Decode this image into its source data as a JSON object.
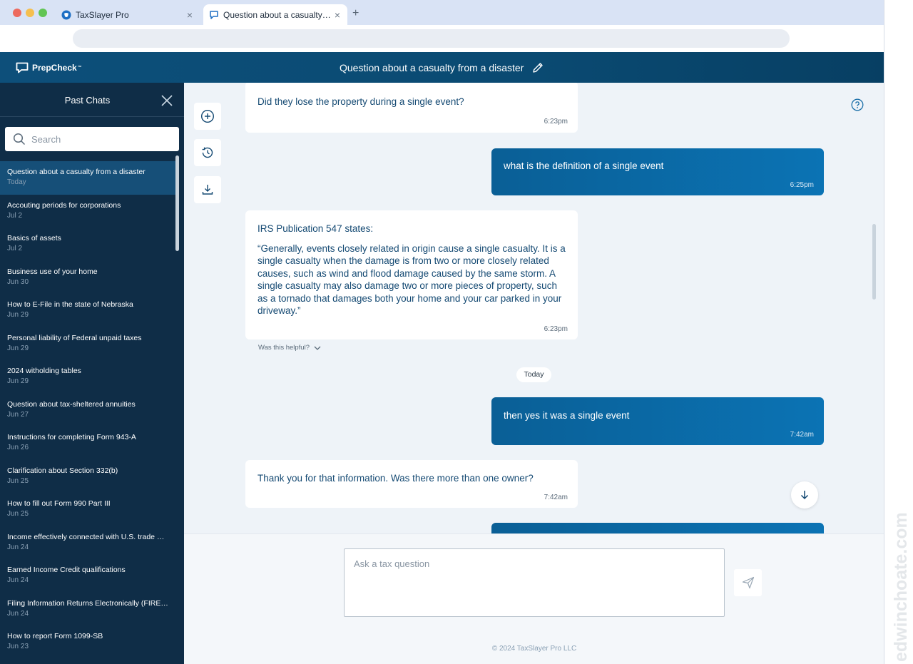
{
  "browser": {
    "tabs": [
      {
        "title": "TaxSlayer Pro",
        "close": "×"
      },
      {
        "title": "Question about a casualty fr...",
        "close": "×"
      }
    ],
    "new_tab": "+"
  },
  "header": {
    "logo_text": "PrepCheck",
    "logo_tm": "™",
    "chat_title": "Question about a casualty from a disaster"
  },
  "sidebar": {
    "title": "Past Chats",
    "search_placeholder": "Search",
    "items": [
      {
        "title": "Question about a casualty from a disaster",
        "date": "Today"
      },
      {
        "title": "Accouting periods for corporations",
        "date": "Jul 2"
      },
      {
        "title": "Basics of assets",
        "date": "Jul 2"
      },
      {
        "title": "Business use of your home",
        "date": "Jun 30"
      },
      {
        "title": "How to E-File in the state of Nebraska",
        "date": "Jun 29"
      },
      {
        "title": "Personal liability of Federal unpaid taxes",
        "date": "Jun 29"
      },
      {
        "title": "2024 witholding tables",
        "date": "Jun 29"
      },
      {
        "title": "Question about tax-sheltered annuities",
        "date": "Jun 27"
      },
      {
        "title": "Instructions for completing Form 943-A",
        "date": "Jun 26"
      },
      {
        "title": "Clarification about Section 332(b)",
        "date": "Jun 25"
      },
      {
        "title": "How to fill out Form 990 Part III",
        "date": "Jun 25"
      },
      {
        "title": "Income effectively connected with U.S. trade or...",
        "date": "Jun 24"
      },
      {
        "title": "Earned Income Credit qualifications",
        "date": "Jun 24"
      },
      {
        "title": "Filing Information Returns Electronically (FIRE)...",
        "date": "Jun 24"
      },
      {
        "title": "How to report Form 1099-SB",
        "date": "Jun 23"
      }
    ]
  },
  "messages": [
    {
      "role": "bot",
      "text": "Did they lose the property during a single event?",
      "time": "6:23pm"
    },
    {
      "role": "user",
      "text": "what is the definition of a single event",
      "time": "6:25pm"
    },
    {
      "role": "bot",
      "intro": "IRS Publication 547 states:",
      "quote": "“Generally, events closely related in origin cause a single casualty. It is a single casualty when the damage is from two or more closely related causes, such as wind and flood damage caused by the same storm. A single casualty may also damage two or more pieces of property, such as a tornado that damages both your home and your car parked in your driveway.”",
      "time": "6:23pm"
    },
    {
      "role": "user",
      "text": "then yes it was a single event",
      "time": "7:42am"
    },
    {
      "role": "bot",
      "text": "Thank you for that information. Was there more than one owner?",
      "time": "7:42am"
    }
  ],
  "feedback_prompt": "Was this helpful?",
  "day_separator": "Today",
  "composer": {
    "placeholder": "Ask a tax question"
  },
  "footer": {
    "copyright": "© 2024 TaxSlayer Pro LLC"
  },
  "watermark": "edwinchoate.com",
  "colors": {
    "header": "#0a4a72",
    "sidebar": "#0f2d47",
    "sidebar_active": "#164f78",
    "user_bubble": "#0b6aa8",
    "bot_text": "#154a73",
    "main_bg": "#eef3f8"
  }
}
